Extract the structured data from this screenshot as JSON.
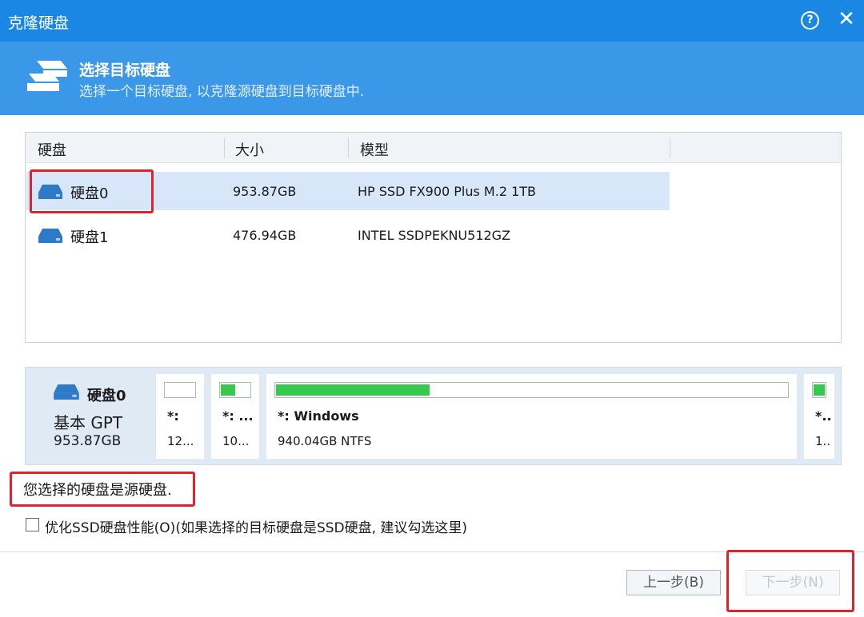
{
  "window": {
    "title": "克隆硬盘",
    "help_icon": "?",
    "close_icon": "✕"
  },
  "banner": {
    "heading": "选择目标硬盘",
    "subheading": "选择一个目标硬盘, 以克隆源硬盘到目标硬盘中."
  },
  "table": {
    "columns": [
      "硬盘",
      "大小",
      "模型"
    ],
    "rows": [
      {
        "name": "硬盘0",
        "size": "953.87GB",
        "model": "HP SSD FX900 Plus M.2 1TB",
        "selected": true
      },
      {
        "name": "硬盘1",
        "size": "476.94GB",
        "model": "INTEL SSDPEKNU512GZ",
        "selected": false
      }
    ]
  },
  "disk_map": {
    "name": "硬盘0",
    "type": "基本 GPT",
    "capacity": "953.87GB",
    "partitions": [
      {
        "label": "*:",
        "size": "12...",
        "used_fraction": 0
      },
      {
        "label": "*: ...",
        "size": "10...",
        "used_fraction": 0.5
      },
      {
        "label": "*: Windows",
        "size": "940.04GB NTFS",
        "used_fraction": 0.3
      },
      {
        "label": "*..",
        "size": "1..",
        "used_fraction": 1.0
      }
    ]
  },
  "message": "您选择的硬盘是源硬盘.",
  "option": {
    "checked": false,
    "label": "优化SSD硬盘性能(O)(如果选择的目标硬盘是SSD硬盘, 建议勾选这里)"
  },
  "buttons": {
    "back": "上一步(B)",
    "next": "下一步(N)"
  },
  "colors": {
    "titlebar": "#1b87e5",
    "banner": "#3b98e9",
    "selected_row": "#d7e7f9",
    "partition_fill": "#36c94e",
    "highlight": "#e0222b"
  }
}
